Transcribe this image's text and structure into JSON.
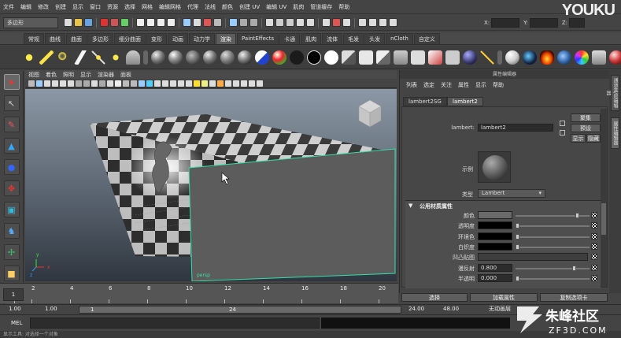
{
  "menubar": {
    "items": [
      "文件",
      "编辑",
      "修改",
      "创建",
      "显示",
      "窗口",
      "资源",
      "选择",
      "网格",
      "编辑网格",
      "代理",
      "法线",
      "颜色",
      "创建 UV",
      "编辑 UV",
      "肌肉",
      "管道缓存",
      "帮助"
    ]
  },
  "brand": {
    "logo_text": "YOUKU"
  },
  "statusline": {
    "mode_dropdown": "多边形",
    "coord_labels": [
      "X:",
      "Y:",
      "Z:"
    ]
  },
  "shelf": {
    "tabs": [
      "常规",
      "曲线",
      "曲面",
      "多边形",
      "细分曲面",
      "变形",
      "动画",
      "动力学",
      "渲染",
      "PaintEffects",
      "卡通",
      "肌肉",
      "流体",
      "毛发",
      "头发",
      "nCloth",
      "自定义"
    ],
    "active_tab": "渲染"
  },
  "viewport": {
    "menu": [
      "视图",
      "着色",
      "照明",
      "显示",
      "渲染器",
      "面板"
    ],
    "camera_label": "persp",
    "axis_labels": [
      "x",
      "y",
      "z"
    ]
  },
  "attribute_editor": {
    "title": "属性编辑器",
    "menu": [
      "列表",
      "选定",
      "关注",
      "属性",
      "显示",
      "帮助"
    ],
    "tabs": [
      "lambert2SG",
      "lambert2"
    ],
    "active_tab": "lambert2",
    "node_label": "lambert:",
    "node_name": "lambert2",
    "buttons": {
      "focus": "聚集",
      "presets": "预设",
      "show": "显示",
      "hide": "隐藏"
    },
    "sample_label": "示例",
    "type_label": "类型",
    "type_value": "Lambert",
    "section_title": "公用材质属性",
    "attributes": [
      {
        "label": "颜色",
        "value": "",
        "swatch": "#6a6a6a",
        "slider": 0.84
      },
      {
        "label": "透明度",
        "value": "",
        "swatch": "#000000",
        "slider": 0.0
      },
      {
        "label": "环境色",
        "value": "",
        "swatch": "#000000",
        "slider": 0.0
      },
      {
        "label": "白炽度",
        "value": "",
        "swatch": "#000000",
        "slider": 0.0
      },
      {
        "label": "凹凸贴图",
        "value": "",
        "swatch": "",
        "slider": null
      },
      {
        "label": "漫反射",
        "value": "0.800",
        "swatch": "",
        "slider": 0.8
      },
      {
        "label": "半透明",
        "value": "0.000",
        "swatch": "",
        "slider": 0.0
      }
    ],
    "bottom_buttons": [
      "选择",
      "加载属性",
      "复制选项卡"
    ]
  },
  "right_tabs": [
    "通道盒/层编辑器",
    "属性编辑器"
  ],
  "timeslider": {
    "ticks": [
      "1",
      "2",
      "4",
      "6",
      "8",
      "10",
      "12",
      "14",
      "16",
      "18",
      "20"
    ],
    "current_frame": "1"
  },
  "range": {
    "start": "1.00",
    "start2": "1.00",
    "range_start": "1",
    "range_end": "24",
    "end": "24.00",
    "end2": "48.00",
    "anim_layer": "无动画层"
  },
  "cmdline": {
    "label": "MEL"
  },
  "helpline": {
    "text": "显示工具: 对选择一个对象"
  },
  "watermark": {
    "brand": "朱峰社区",
    "url": "ZF3D.COM"
  }
}
